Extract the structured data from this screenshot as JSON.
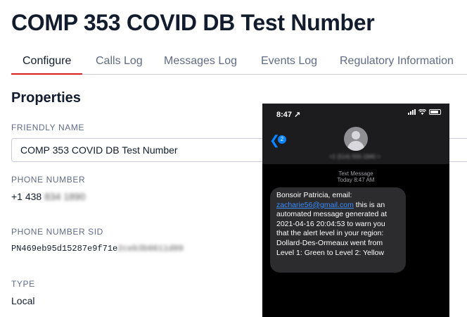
{
  "page": {
    "title": "COMP 353 COVID DB Test Number"
  },
  "tabs": [
    {
      "label": "Configure",
      "active": true
    },
    {
      "label": "Calls Log",
      "active": false
    },
    {
      "label": "Messages Log",
      "active": false
    },
    {
      "label": "Events Log",
      "active": false
    },
    {
      "label": "Regulatory Information",
      "active": false
    }
  ],
  "properties": {
    "heading": "Properties",
    "friendly_name": {
      "label": "FRIENDLY NAME",
      "value": "COMP 353 COVID DB Test Number"
    },
    "phone_number": {
      "label": "PHONE NUMBER",
      "visible": "+1 438",
      "redacted": "834 1890"
    },
    "phone_number_sid": {
      "label": "PHONE NUMBER SID",
      "visible": "PN469eb95d15287e9f71e",
      "redacted": "2ceb3b6611d09"
    },
    "type": {
      "label": "TYPE",
      "value": "Local"
    }
  },
  "phone_screenshot": {
    "status_time": "8:47 ↗",
    "back_badge": "2",
    "contact_redacted": "+1 (514) 555-1840 >",
    "message_meta_1": "Text Message",
    "message_meta_2": "Today 8:47 AM",
    "message": {
      "before_link": "Bonsoir Patricia, email: ",
      "link": "zacharie56@gmail.com",
      "after_link": " this is an automated message generated at 2021-04-16 20:04:53 to warn you that the alert level in your region: Dollard-Des-Ormeaux went from Level 1: Green to Level 2: Yellow"
    },
    "colors": {
      "bubble": "#2c2c2e",
      "link": "#3a8dff",
      "accent": "#0a84ff"
    }
  },
  "colors": {
    "tab_indicator": "#d61f1f",
    "text_primary": "#121c2d",
    "text_secondary": "#606b85"
  }
}
